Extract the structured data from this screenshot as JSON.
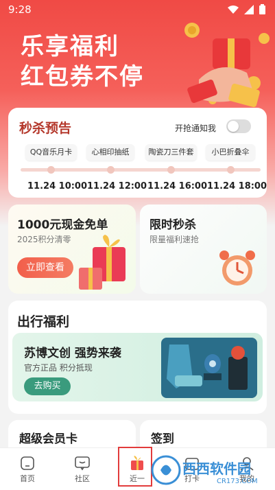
{
  "status_bar": {
    "time": "9:28"
  },
  "hero": {
    "line1": "乐享福利",
    "line2": "红包券不停"
  },
  "flash": {
    "title": "秒杀预告",
    "toggle_label": "开抢通知我",
    "toggle_on": false,
    "items": [
      {
        "name": "QQ音乐月卡",
        "time": "11.24 10:00"
      },
      {
        "name": "心相印抽纸",
        "time": "11.24 12:00"
      },
      {
        "name": "陶瓷刀三件套",
        "time": "11.24 16:00"
      },
      {
        "name": "小巴折叠伞",
        "time": "11.24 18:00"
      }
    ]
  },
  "promo_left": {
    "title": "1000元现金免单",
    "subtitle": "2025积分清零",
    "button": "立即查看"
  },
  "promo_right": {
    "title": "限时秒杀",
    "subtitle": "限量福利速抢"
  },
  "travel": {
    "section_title": "出行福利",
    "banner_title": "苏博文创 强势来袭",
    "banner_sub": "官方正品 积分抵现",
    "button": "去购买"
  },
  "bottom_cards": {
    "left_title": "超级会员卡",
    "right_title": "签到"
  },
  "tabbar": {
    "tabs": [
      {
        "label": "首页",
        "icon": "home-icon"
      },
      {
        "label": "社区",
        "icon": "chat-icon"
      },
      {
        "label": "近一",
        "icon": "gift-icon"
      },
      {
        "label": "打卡",
        "icon": "calendar-icon"
      },
      {
        "label": "我的",
        "icon": "user-icon"
      }
    ]
  },
  "watermark": {
    "brand": "西西软件园",
    "url": "CR173.COM"
  },
  "colors": {
    "brand_red": "#f04a45",
    "flash_title": "#b4372a",
    "green_button": "#3a9b7d"
  }
}
